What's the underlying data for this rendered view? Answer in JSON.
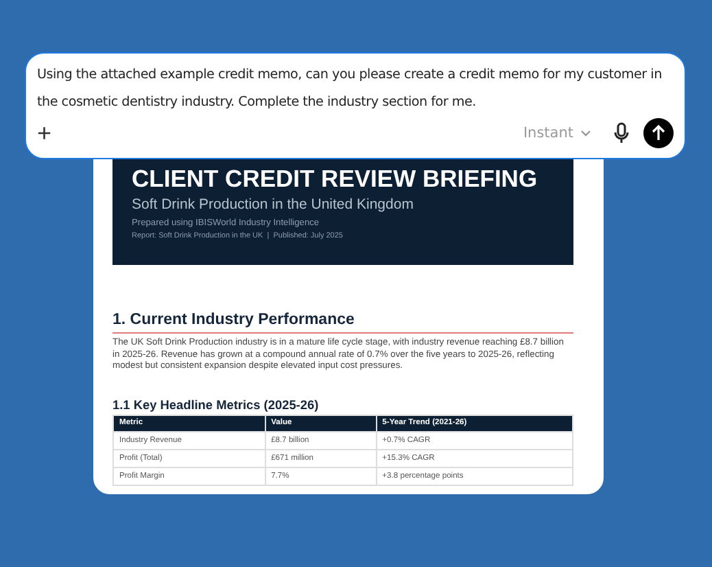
{
  "prompt": {
    "text": "Using the attached example credit memo, can you please create a credit memo for my customer in the cosmetic dentistry industry. Complete the industry section for me.",
    "add_label": "+",
    "model": "Instant"
  },
  "document": {
    "title": "CLIENT CREDIT REVIEW BRIEFING",
    "subtitle": "Soft Drink Production in the United Kingdom",
    "prepared": "Prepared using IBISWorld Industry Intelligence",
    "report": "Report: Soft Drink Production in the UK  |  Published: July 2025",
    "section": "1. Current Industry Performance",
    "paragraph": "The UK Soft Drink Production industry is in a mature life cycle stage, with industry revenue reaching £8.7 billion in 2025-26. Revenue has grown at a compound annual rate of 0.7% over the five years to 2025-26, reflecting modest but consistent expansion despite elevated input cost pressures.",
    "subsection": "1.1  Key Headline Metrics (2025-26)",
    "table": {
      "columns": [
        "Metric",
        "Value",
        "5-Year Trend (2021-26)"
      ],
      "rows": [
        [
          "Industry Revenue",
          "£8.7 billion",
          "+0.7% CAGR"
        ],
        [
          "Profit (Total)",
          "£671 million",
          "+15.3% CAGR"
        ],
        [
          "Profit Margin",
          "7.7%",
          "+3.8 percentage points"
        ]
      ]
    }
  }
}
